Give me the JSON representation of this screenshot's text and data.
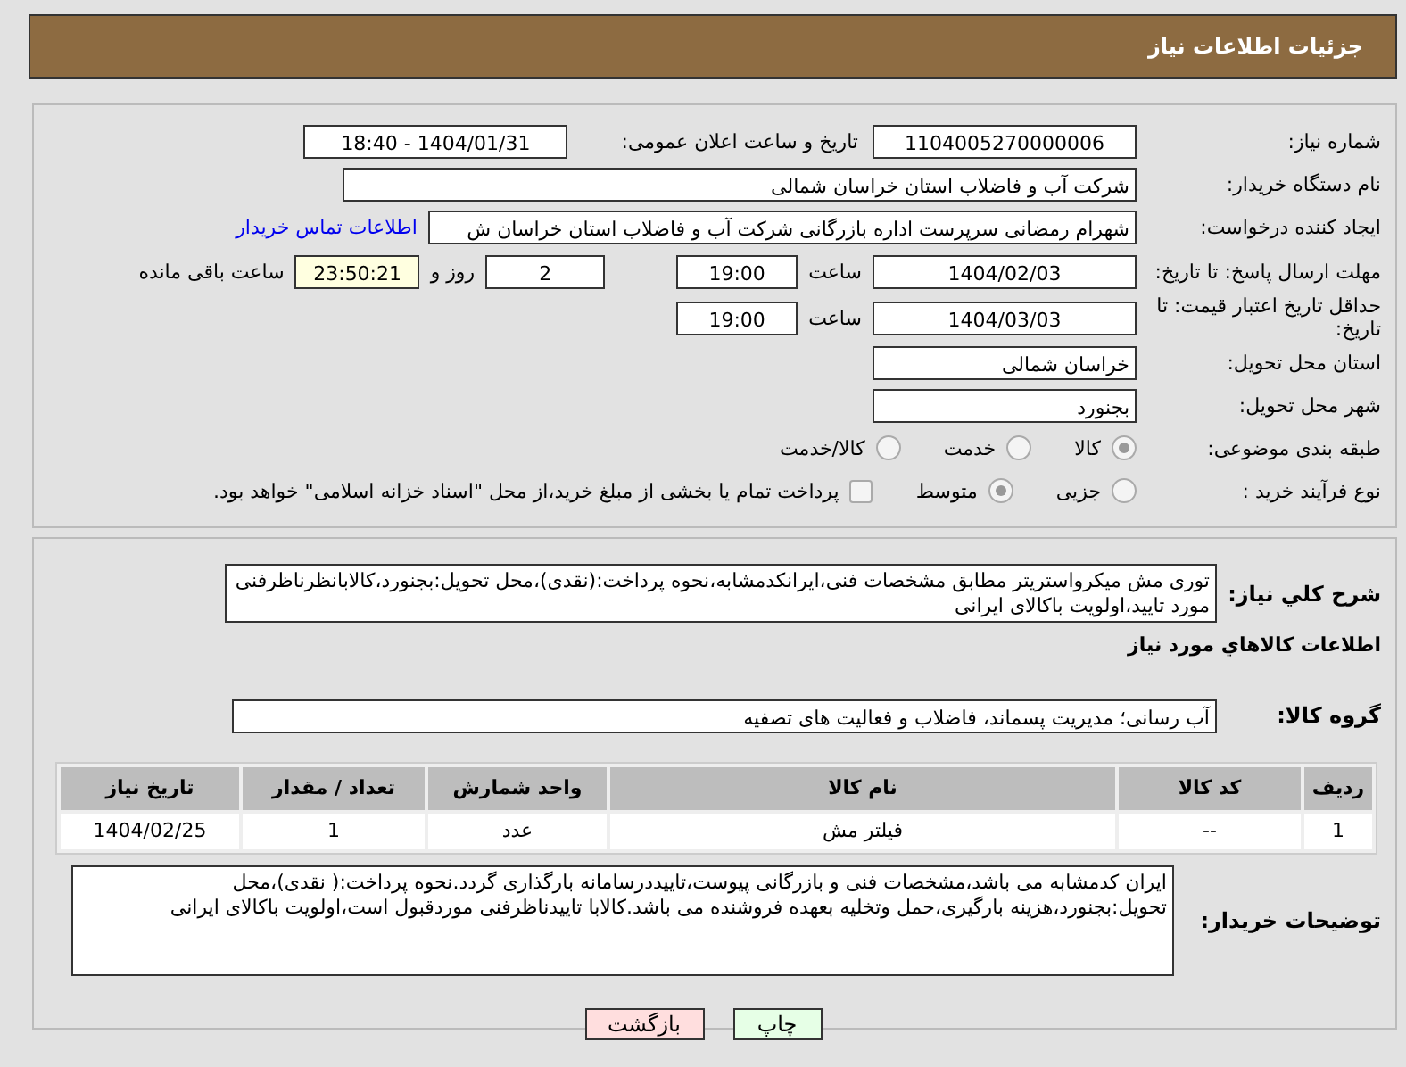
{
  "header": {
    "title": "جزئیات اطلاعات نیاز"
  },
  "need_number": {
    "label": "شماره نیاز:",
    "value": "1104005270000006"
  },
  "announce": {
    "label": "تاریخ و ساعت اعلان عمومی:",
    "value": "1404/01/31 - 18:40"
  },
  "buyer": {
    "label": "نام دستگاه خریدار:",
    "value": "شرکت آب و فاضلاب استان خراسان شمالی"
  },
  "requester": {
    "label": "ایجاد کننده درخواست:",
    "value": "شهرام رمضانی سرپرست اداره بازرگانی  شرکت آب و فاضلاب استان خراسان ش",
    "link": "اطلاعات تماس خریدار"
  },
  "deadline": {
    "label": "مهلت ارسال پاسخ: تا تاریخ:",
    "date": "1404/02/03",
    "time_label": "ساعت",
    "time": "19:00",
    "days": "2",
    "days_label": "روز و",
    "remaining": "23:50:21",
    "remaining_label": "ساعت باقی مانده"
  },
  "validity": {
    "label": "حداقل تاریخ اعتبار قیمت: تا تاریخ:",
    "date": "1404/03/03",
    "time_label": "ساعت",
    "time": "19:00"
  },
  "province": {
    "label": "استان محل تحویل:",
    "value": "خراسان شمالی"
  },
  "city": {
    "label": "شهر محل تحویل:",
    "value": "بجنورد"
  },
  "category": {
    "label": "طبقه بندی موضوعی:",
    "options": [
      {
        "label": "کالا",
        "selected": true
      },
      {
        "label": "خدمت",
        "selected": false
      },
      {
        "label": "کالا/خدمت",
        "selected": false
      }
    ]
  },
  "purchase_type": {
    "label": "نوع فرآیند خرید :",
    "options": [
      {
        "label": "جزیی",
        "selected": false
      },
      {
        "label": "متوسط",
        "selected": true
      }
    ],
    "payment": {
      "checked": false,
      "label": "پرداخت تمام یا بخشی از مبلغ خرید،از محل \"اسناد خزانه اسلامی\" خواهد بود."
    }
  },
  "summary": {
    "label": "شرح کلي نياز:",
    "value": "توری مش میکرواستریتر مطابق مشخصات فنی،ایرانکدمشابه،نحوه پرداخت:(نقدی)،محل تحویل:بجنورد،کالابانظرناظرفنی مورد تایید،اولویت باکالای ایرانی"
  },
  "goods_heading": "اطلاعات کالاهاي مورد نياز",
  "goods_group": {
    "label": "گروه کالا:",
    "value": "آب رسانی؛ مدیریت پسماند، فاضلاب و فعالیت های تصفیه"
  },
  "table": {
    "columns": [
      "ردیف",
      "کد کالا",
      "نام کالا",
      "واحد شمارش",
      "تعداد / مقدار",
      "تاریخ نیاز"
    ],
    "rows": [
      [
        "1",
        "--",
        "فیلتر مش",
        "عدد",
        "1",
        "1404/02/25"
      ]
    ]
  },
  "buyer_notes": {
    "label": "توضیحات خریدار:",
    "value": "ایران کدمشابه می باشد،مشخصات فنی و بازرگانی پیوست،تاییددرسامانه بارگذاری گردد.نحوه پرداخت:( نقدی)،محل تحویل:بجنورد،هزینه بارگیری،حمل وتخلیه بعهده فروشنده می باشد.کالابا تاییدناظرفنی موردقبول است،اولویت باکالای ایرانی"
  },
  "buttons": [
    {
      "kind": "print",
      "label": "چاپ"
    },
    {
      "kind": "back",
      "label": "بازگشت"
    }
  ]
}
